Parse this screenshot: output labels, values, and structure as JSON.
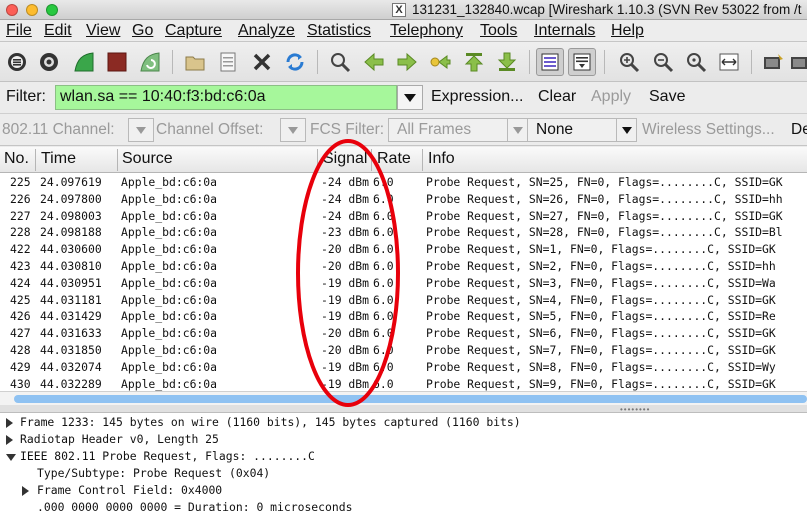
{
  "window": {
    "title": "131231_132840.wcap  [Wireshark 1.10.3  (SVN Rev 53022 from /t"
  },
  "menu": [
    {
      "label": "File"
    },
    {
      "label": "Edit"
    },
    {
      "label": "View"
    },
    {
      "label": "Go"
    },
    {
      "label": "Capture"
    },
    {
      "label": "Analyze"
    },
    {
      "label": "Statistics"
    },
    {
      "label": "Telephony"
    },
    {
      "label": "Tools"
    },
    {
      "label": "Internals"
    },
    {
      "label": "Help"
    }
  ],
  "toolbar": {
    "icons": [
      "interfaces-icon",
      "options-icon",
      "start-capture-icon",
      "stop-capture-icon",
      "restart-capture-icon",
      "open-file-icon",
      "save-file-icon",
      "close-file-icon",
      "reload-icon",
      "find-icon",
      "back-icon",
      "forward-icon",
      "go-to-packet-icon",
      "first-packet-icon",
      "last-packet-icon",
      "colorize-icon",
      "auto-scroll-icon",
      "zoom-in-icon",
      "zoom-out-icon",
      "normal-size-icon",
      "resize-columns-icon",
      "capture-filters-icon",
      "display-filters-icon"
    ]
  },
  "filter": {
    "label": "Filter:",
    "value": "wlan.sa == 10:40:f3:bd:c6:0a",
    "expression_label": "Expression...",
    "clear_label": "Clear",
    "apply_label": "Apply",
    "save_label": "Save",
    "valid_color": "#a6f79b"
  },
  "wireless": {
    "channel_label": "802.11 Channel:",
    "offset_label": "Channel Offset:",
    "fcs_label": "FCS Filter:",
    "fcs_value": "All Frames",
    "decrypt_value": "None",
    "settings_label": "Wireless Settings...",
    "trailing_label": "De"
  },
  "packet_list": {
    "columns": [
      "No.",
      "Time",
      "Source",
      "Signal",
      "Rate",
      "Info"
    ],
    "rows": [
      {
        "no": "225",
        "time": "24.097619",
        "source": "Apple_bd:c6:0a",
        "signal": "-24 dBm",
        "rate": "6.0",
        "info": "Probe Request, SN=25, FN=0, Flags=........C, SSID=GK"
      },
      {
        "no": "226",
        "time": "24.097800",
        "source": "Apple_bd:c6:0a",
        "signal": "-24 dBm",
        "rate": "6.0",
        "info": "Probe Request, SN=26, FN=0, Flags=........C, SSID=hh"
      },
      {
        "no": "227",
        "time": "24.098003",
        "source": "Apple_bd:c6:0a",
        "signal": "-24 dBm",
        "rate": "6.0",
        "info": "Probe Request, SN=27, FN=0, Flags=........C, SSID=GK"
      },
      {
        "no": "228",
        "time": "24.098188",
        "source": "Apple_bd:c6:0a",
        "signal": "-23 dBm",
        "rate": "6.0",
        "info": "Probe Request, SN=28, FN=0, Flags=........C, SSID=Bl"
      },
      {
        "no": "422",
        "time": "44.030600",
        "source": "Apple_bd:c6:0a",
        "signal": "-20 dBm",
        "rate": "6.0",
        "info": "Probe Request, SN=1, FN=0, Flags=........C, SSID=GK"
      },
      {
        "no": "423",
        "time": "44.030810",
        "source": "Apple_bd:c6:0a",
        "signal": "-20 dBm",
        "rate": "6.0",
        "info": "Probe Request, SN=2, FN=0, Flags=........C, SSID=hh"
      },
      {
        "no": "424",
        "time": "44.030951",
        "source": "Apple_bd:c6:0a",
        "signal": "-19 dBm",
        "rate": "6.0",
        "info": "Probe Request, SN=3, FN=0, Flags=........C, SSID=Wa"
      },
      {
        "no": "425",
        "time": "44.031181",
        "source": "Apple_bd:c6:0a",
        "signal": "-19 dBm",
        "rate": "6.0",
        "info": "Probe Request, SN=4, FN=0, Flags=........C, SSID=GK"
      },
      {
        "no": "426",
        "time": "44.031429",
        "source": "Apple_bd:c6:0a",
        "signal": "-19 dBm",
        "rate": "6.0",
        "info": "Probe Request, SN=5, FN=0, Flags=........C, SSID=Re"
      },
      {
        "no": "427",
        "time": "44.031633",
        "source": "Apple_bd:c6:0a",
        "signal": "-20 dBm",
        "rate": "6.0",
        "info": "Probe Request, SN=6, FN=0, Flags=........C, SSID=GK"
      },
      {
        "no": "428",
        "time": "44.031850",
        "source": "Apple_bd:c6:0a",
        "signal": "-20 dBm",
        "rate": "6.0",
        "info": "Probe Request, SN=7, FN=0, Flags=........C, SSID=GK"
      },
      {
        "no": "429",
        "time": "44.032074",
        "source": "Apple_bd:c6:0a",
        "signal": "-19 dBm",
        "rate": "6.0",
        "info": "Probe Request, SN=8, FN=0, Flags=........C, SSID=Wy"
      },
      {
        "no": "430",
        "time": "44.032289",
        "source": "Apple_bd:c6:0a",
        "signal": "-19 dBm",
        "rate": "6.0",
        "info": "Probe Request, SN=9, FN=0, Flags=........C, SSID=GK"
      }
    ]
  },
  "details": [
    {
      "text": "Frame 1233: 145 bytes on wire (1160 bits), 145 bytes captured (1160 bits)",
      "state": "collapsed"
    },
    {
      "text": "Radiotap Header v0, Length 25",
      "state": "collapsed"
    },
    {
      "text": "IEEE 802.11 Probe Request, Flags: ........C",
      "state": "expanded"
    },
    {
      "text": "Type/Subtype: Probe Request (0x04)",
      "state": "leaf"
    },
    {
      "text": "Frame Control Field: 0x4000",
      "state": "collapsed"
    },
    {
      "text": ".000 0000 0000 0000 = Duration: 0 microseconds",
      "state": "leaf"
    }
  ],
  "annotation": {
    "shape": "ellipse",
    "color": "#e8000b",
    "target": "Signal column"
  }
}
